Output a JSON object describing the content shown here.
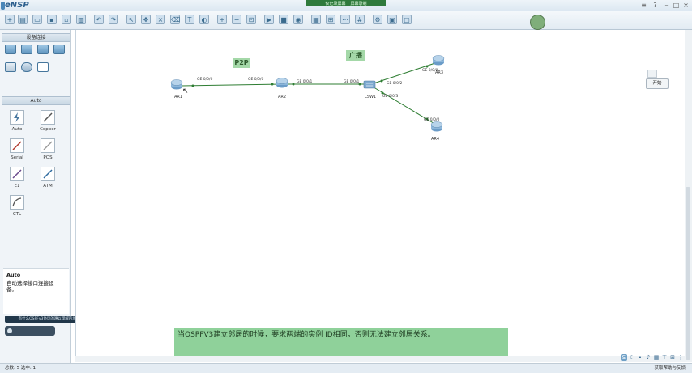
{
  "window": {
    "title": "eNSP"
  },
  "recording_bar": {
    "label_left": "仅记录屏幕",
    "label_right": "屏幕录制"
  },
  "left_panel": {
    "devices_header": "设备连接",
    "links_header": "Auto",
    "links": [
      {
        "label": "Auto"
      },
      {
        "label": "Copper"
      },
      {
        "label": "Serial"
      },
      {
        "label": "POS"
      },
      {
        "label": "E1"
      },
      {
        "label": "ATM"
      },
      {
        "label": "CTL"
      }
    ],
    "description": {
      "title": "Auto",
      "text": "自动选择接口连接设备。"
    }
  },
  "tooltip_bar": {
    "text": "有什么OSPFv3协议的难以理解的地方"
  },
  "tooltip_pill": {
    "text": ""
  },
  "canvas": {
    "annotations": {
      "p2p": "P2P",
      "broadcast": "广播"
    },
    "devices": {
      "ar1": "AR1",
      "ar2": "AR2",
      "lsw1": "LSW1",
      "ar3": "AR3",
      "ar4": "AR4"
    },
    "ports": {
      "ar1_ge000": "GE 0/0/0",
      "ar2_ge000": "GE 0/0/0",
      "ar2_ge001": "GE 0/0/1",
      "lsw_ge001": "GE 0/0/1",
      "lsw_ge002": "GE 0/0/2",
      "lsw_ge003": "GE 0/0/3",
      "ar3_ge000": "GE 0/0/0",
      "ar4_ge000": "GE 0/0/0"
    },
    "start_button": "开始"
  },
  "subtitle": {
    "text": "当OSPFV3建立邻居的时候，要求两端的实例 ID相同，否则无法建立邻居关系。"
  },
  "statusbar": {
    "left": "总数: 5 选中: 1",
    "right": "获取帮助与反馈"
  },
  "colors": {
    "link_green": "#2e7d32",
    "annotation_bg": "#a4d8a8",
    "subtitle_bg": "#8fd19a",
    "router_blue": "#6b9cc8"
  }
}
